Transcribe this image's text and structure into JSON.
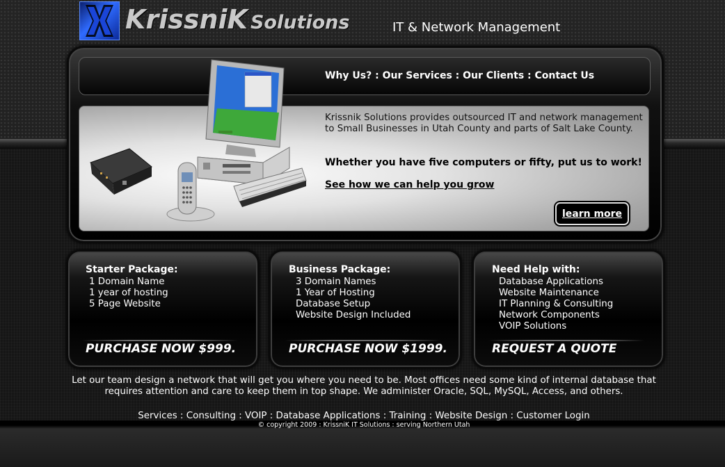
{
  "header": {
    "logo_main": "KrissniK",
    "logo_sub": "Solutions",
    "tagline": "IT & Network Management"
  },
  "nav": {
    "items": [
      "Why Us?",
      "Our Services",
      "Our Clients",
      "Contact Us"
    ],
    "separator": " : "
  },
  "hero": {
    "intro": "Krissnik Solutions provides outsourced IT and network management to Small Businesses in Utah County and parts of Salt Lake County.",
    "strong_line": "Whether you have five computers or fifty, put us to work!",
    "link_text": "See how we can help you grow",
    "button_label": "learn more",
    "illustration_icons": [
      "computer-icon",
      "modem-icon",
      "phone-icon",
      "keyboard-icon"
    ]
  },
  "packages": [
    {
      "title": "Starter Package:",
      "items": [
        "1 Domain Name",
        "1 year of hosting",
        "5 Page Website"
      ],
      "cta": "PURCHASE NOW  $999."
    },
    {
      "title": "Business Package:",
      "items": [
        "3 Domain Names",
        "1 Year of Hosting",
        "Database Setup",
        "Website Design Included"
      ],
      "cta": "PURCHASE NOW $1999."
    },
    {
      "title": "Need Help with:",
      "items": [
        "Database Applications",
        "Website Maintenance",
        "IT Planning & Consulting",
        "Network Components",
        "VOIP Solutions"
      ],
      "cta": "REQUEST A QUOTE"
    }
  ],
  "blurb": "Let our team design a network that will get you where you need to be.   Most offices need some kind of internal database that requires attention and care to keep them in top shape.   We administer Oracle, SQL, MySQL, Access, and others.",
  "footer": {
    "links": [
      "Services",
      "Consulting",
      "VOIP",
      "Database Applications",
      "Training",
      "Website Design",
      "Customer Login"
    ],
    "copyright": "© copyright 2009 : KrissniK IT Solutions : serving Northern Utah"
  },
  "colors": {
    "logo_blue": "#2f6bff",
    "background": "#1c1c1c",
    "text": "#ffffff"
  }
}
